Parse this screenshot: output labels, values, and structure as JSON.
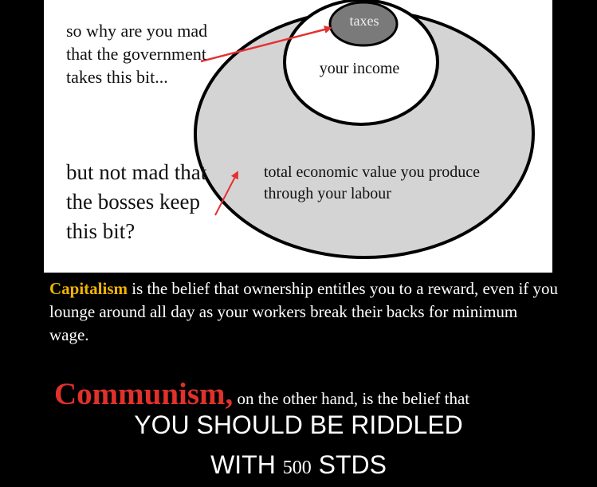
{
  "diagram": {
    "question_top": "so why are you mad that the government takes this bit...",
    "question_bottom": "but not mad that the bosses keep this bit?",
    "labels": {
      "taxes": "taxes",
      "income": "your income",
      "total": "total economic value you produce through your labour"
    },
    "colors": {
      "outer_fill": "#d4d4d4",
      "income_fill": "#ffffff",
      "taxes_fill": "#7a7a7a",
      "arrow": "#e53030"
    }
  },
  "caption": {
    "capitalism_word": "Capitalism",
    "capitalism_text": " is the belief that ownership entitles you to a reward, even if you lounge around all day as your workers break their  backs for minimum wage.",
    "communism_word": "Communism,",
    "communism_text": " on the other hand, is the belief that",
    "colors": {
      "capitalism": "#f0b400",
      "communism": "#e0312b"
    }
  },
  "meme_text": {
    "line1": "YOU SHOULD BE RIDDLED",
    "line2_prefix": "WITH ",
    "line2_number": "500",
    "line2_suffix": " STDS"
  }
}
